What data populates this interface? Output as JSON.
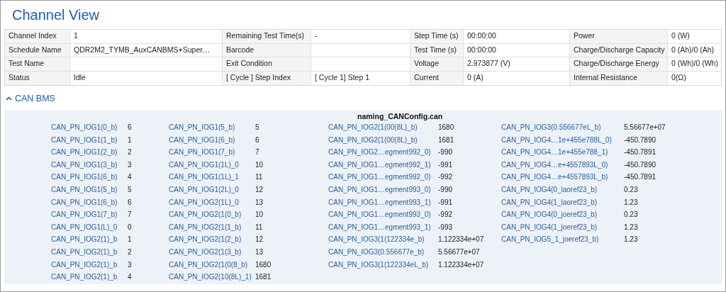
{
  "title": "Channel View",
  "info_table": [
    [
      {
        "label": "Channel Index",
        "value": "1"
      },
      {
        "label": "Remaining Test Time(s)",
        "value": "-"
      },
      {
        "label": "Step Time (s)",
        "value": "00:00:00"
      },
      {
        "label": "Power",
        "value": "0 (W)"
      }
    ],
    [
      {
        "label": "Schedule Name",
        "value": "QDR2M2_TYMB_AuxCANBMS+Super…"
      },
      {
        "label": "Barcode"
      },
      {
        "label": "Test Time (s)",
        "value": "00:00:00"
      },
      {
        "label": "Charge/Discharge Capacity",
        "value": "0 (Ah)/0 (Ah)"
      }
    ],
    [
      {
        "label": "Test Name"
      },
      {
        "label": "Exit Condition"
      },
      {
        "label": "Voltage",
        "value": "2.973877 (V)"
      },
      {
        "label": "Charge/Discharge Energy",
        "value": "0 (Wh)/0 (Wh)"
      }
    ],
    [
      {
        "label": "Status",
        "value": "Idle"
      },
      {
        "label": "[ Cycle ]  Step Index",
        "value": "[ Cycle 1]  Step 1"
      },
      {
        "label": "Current",
        "value": "0 (A)"
      },
      {
        "label": "Internal Resistance",
        "value": "0(Ω)"
      }
    ]
  ],
  "section": {
    "title": "CAN BMS",
    "expanded": true,
    "file": "naming_CANConfig.can",
    "columns": [
      [
        {
          "name": "CAN_PN_IOG1(0_b)",
          "value": "6"
        },
        {
          "name": "CAN_PN_IOG1(1_b)",
          "value": "1"
        },
        {
          "name": "CAN_PN_IOG1(2_b)",
          "value": "2"
        },
        {
          "name": "CAN_PN_IOG1(3_b)",
          "value": "3"
        },
        {
          "name": "CAN_PN_IOG1(6_b)",
          "value": "4"
        },
        {
          "name": "CAN_PN_IOG1(5_b)",
          "value": "5"
        },
        {
          "name": "CAN_PN_IOG1(6_b)",
          "value": "6"
        },
        {
          "name": "CAN_PN_IOG1(7_b)",
          "value": "7"
        },
        {
          "name": "CAN_PN_IOG1(L)_0",
          "value": "0"
        },
        {
          "name": "CAN_PN_IOG2(1)_b",
          "value": "1"
        },
        {
          "name": "CAN_PN_IOG2(1)_b",
          "value": "2"
        },
        {
          "name": "CAN_PN_IOG2(1)_b",
          "value": "3"
        },
        {
          "name": "CAN_PN_IOG2(1)_b",
          "value": "4"
        }
      ],
      [
        {
          "name": "CAN_PN_IOG1(5_b)",
          "value": "5"
        },
        {
          "name": "CAN_PN_IOG1(6_b)",
          "value": "6"
        },
        {
          "name": "CAN_PN_IOG1(7_b)",
          "value": "7"
        },
        {
          "name": "CAN_PN_IOG1(1L)_0",
          "value": "10"
        },
        {
          "name": "CAN_PN_IOG1(1L)_1",
          "value": "11"
        },
        {
          "name": "CAN_PN_IOG1(2L)_0",
          "value": "12"
        },
        {
          "name": "CAN_PN_IOG2(1L)_0",
          "value": "13"
        },
        {
          "name": "CAN_PN_IOG2(1(0_b)",
          "value": "10"
        },
        {
          "name": "CAN_PN_IOG2(1(1_b)",
          "value": "11"
        },
        {
          "name": "CAN_PN_IOG2(1(2_b)",
          "value": "12"
        },
        {
          "name": "CAN_PN_IOG2(1(3_b)",
          "value": "13"
        },
        {
          "name": "CAN_PN_IOG2(1(0(8_b)",
          "value": "1680"
        },
        {
          "name": "CAN_PN_IOG2(10(8L)_1)",
          "value": "1681"
        }
      ],
      [
        {
          "name": "CAN_PN_IOG2(1(00(8L)_b)",
          "value": "1680"
        },
        {
          "name": "CAN_PN_IOG2(1(00(8L)_b)",
          "value": "1681"
        },
        {
          "name": "CAN_PN_IOG2…egment992_0)",
          "value": "-990"
        },
        {
          "name": "CAN_PN_IOG1…egment992_1)",
          "value": "-991"
        },
        {
          "name": "CAN_PN_IOG1…egment992_0)",
          "value": "-992"
        },
        {
          "name": "CAN_PN_IOG1…egment993_0)",
          "value": "-990"
        },
        {
          "name": "CAN_PN_IOG1…egment993_1)",
          "value": "-991"
        },
        {
          "name": "CAN_PN_IOG1…egment993_0)",
          "value": "-992"
        },
        {
          "name": "CAN_PN_IOG1…egment993_1)",
          "value": "-993"
        },
        {
          "name": "CAN_PN_IOG3(1(122334e_b)",
          "value": "1.122334e+07"
        },
        {
          "name": "CAN_PN_IOG3(0.556677e_b)",
          "value": "5.56677e+07"
        },
        {
          "name": "CAN_PN_IOG3(1(122334eL_b)",
          "value": "1.122334e+07"
        }
      ],
      [
        {
          "name": "CAN_PN_IOG3(0.556677eL_b)",
          "value": "5.56677e+07"
        },
        {
          "name": "CAN_PN_IOG4…1e+455e788L_0)",
          "value": "-450.7890"
        },
        {
          "name": "CAN_PN_IOG4…1e+455e788_1)",
          "value": "-450.7891"
        },
        {
          "name": "CAN_PN_IOG4…e+4557893L_0)",
          "value": "-450.7890"
        },
        {
          "name": "CAN_PN_IOG4…e+4557893L_b)",
          "value": "-450.7891"
        },
        {
          "name": "CAN_PN_IOG4(0_laoref23_b)",
          "value": "0.23"
        },
        {
          "name": "CAN_PN_IOG4(1_laoref23_b)",
          "value": "1.23"
        },
        {
          "name": "CAN_PN_IOG4(0_joeref23_b)",
          "value": "0.23"
        },
        {
          "name": "CAN_PN_IOG4(1_joeref23_b)",
          "value": "1.23"
        },
        {
          "name": "CAN_PN_IOG5_1_joeref23_b)",
          "value": "1.23"
        }
      ]
    ]
  }
}
